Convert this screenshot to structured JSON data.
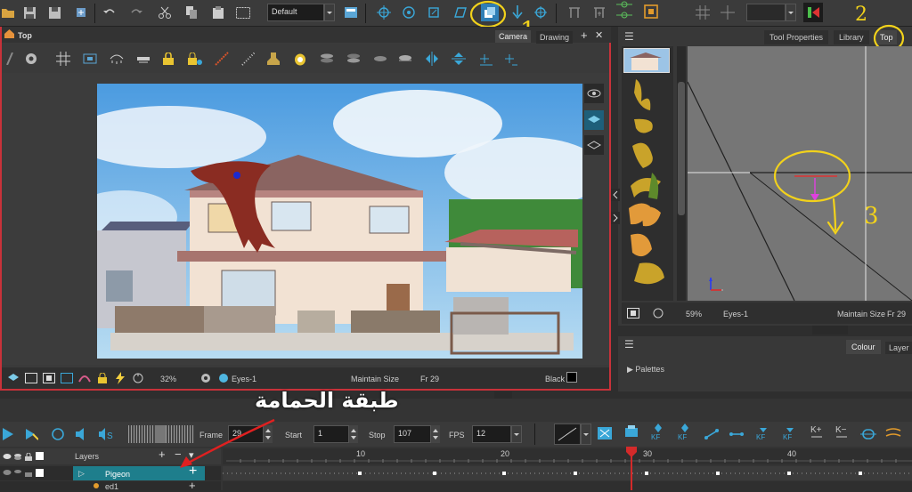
{
  "toolbar": {
    "preset": "Default"
  },
  "camera_tabs": {
    "tab1": "Camera",
    "tab2": "Drawing"
  },
  "view_title": "Top",
  "camera_status": {
    "zoom": "32%",
    "layer": "Eyes-1",
    "mode": "Maintain Size",
    "frame": "Fr 29",
    "bg": "Black"
  },
  "right_tabs": {
    "tool_properties": "Tool Properties",
    "library": "Library",
    "top": "Top"
  },
  "top_status": {
    "zoom": "59%",
    "layer": "Eyes-1",
    "mode": "Maintain Size",
    "frame": "Fr 29"
  },
  "bottom_right": {
    "colour": "Colour",
    "layer": "Layer",
    "palettes": "Palettes"
  },
  "timeline": {
    "frame_label": "Frame",
    "frame_value": "29",
    "start_label": "Start",
    "start_value": "1",
    "stop_label": "Stop",
    "stop_value": "107",
    "fps_label": "FPS",
    "fps_value": "12",
    "layers_label": "Layers",
    "ruler": [
      "10",
      "20",
      "30",
      "40"
    ],
    "layer1": "Pigeon",
    "layer2": "ed1"
  },
  "annotations": {
    "n1": "1",
    "n2": "2",
    "n3": "3",
    "arabic": "طبقة الحمامة"
  },
  "colors": {
    "accent_layer": "#1e7e8c",
    "selection_red": "#d93c3c",
    "annotation_yellow": "#f2d21b",
    "playhead": "#d42a2a"
  }
}
